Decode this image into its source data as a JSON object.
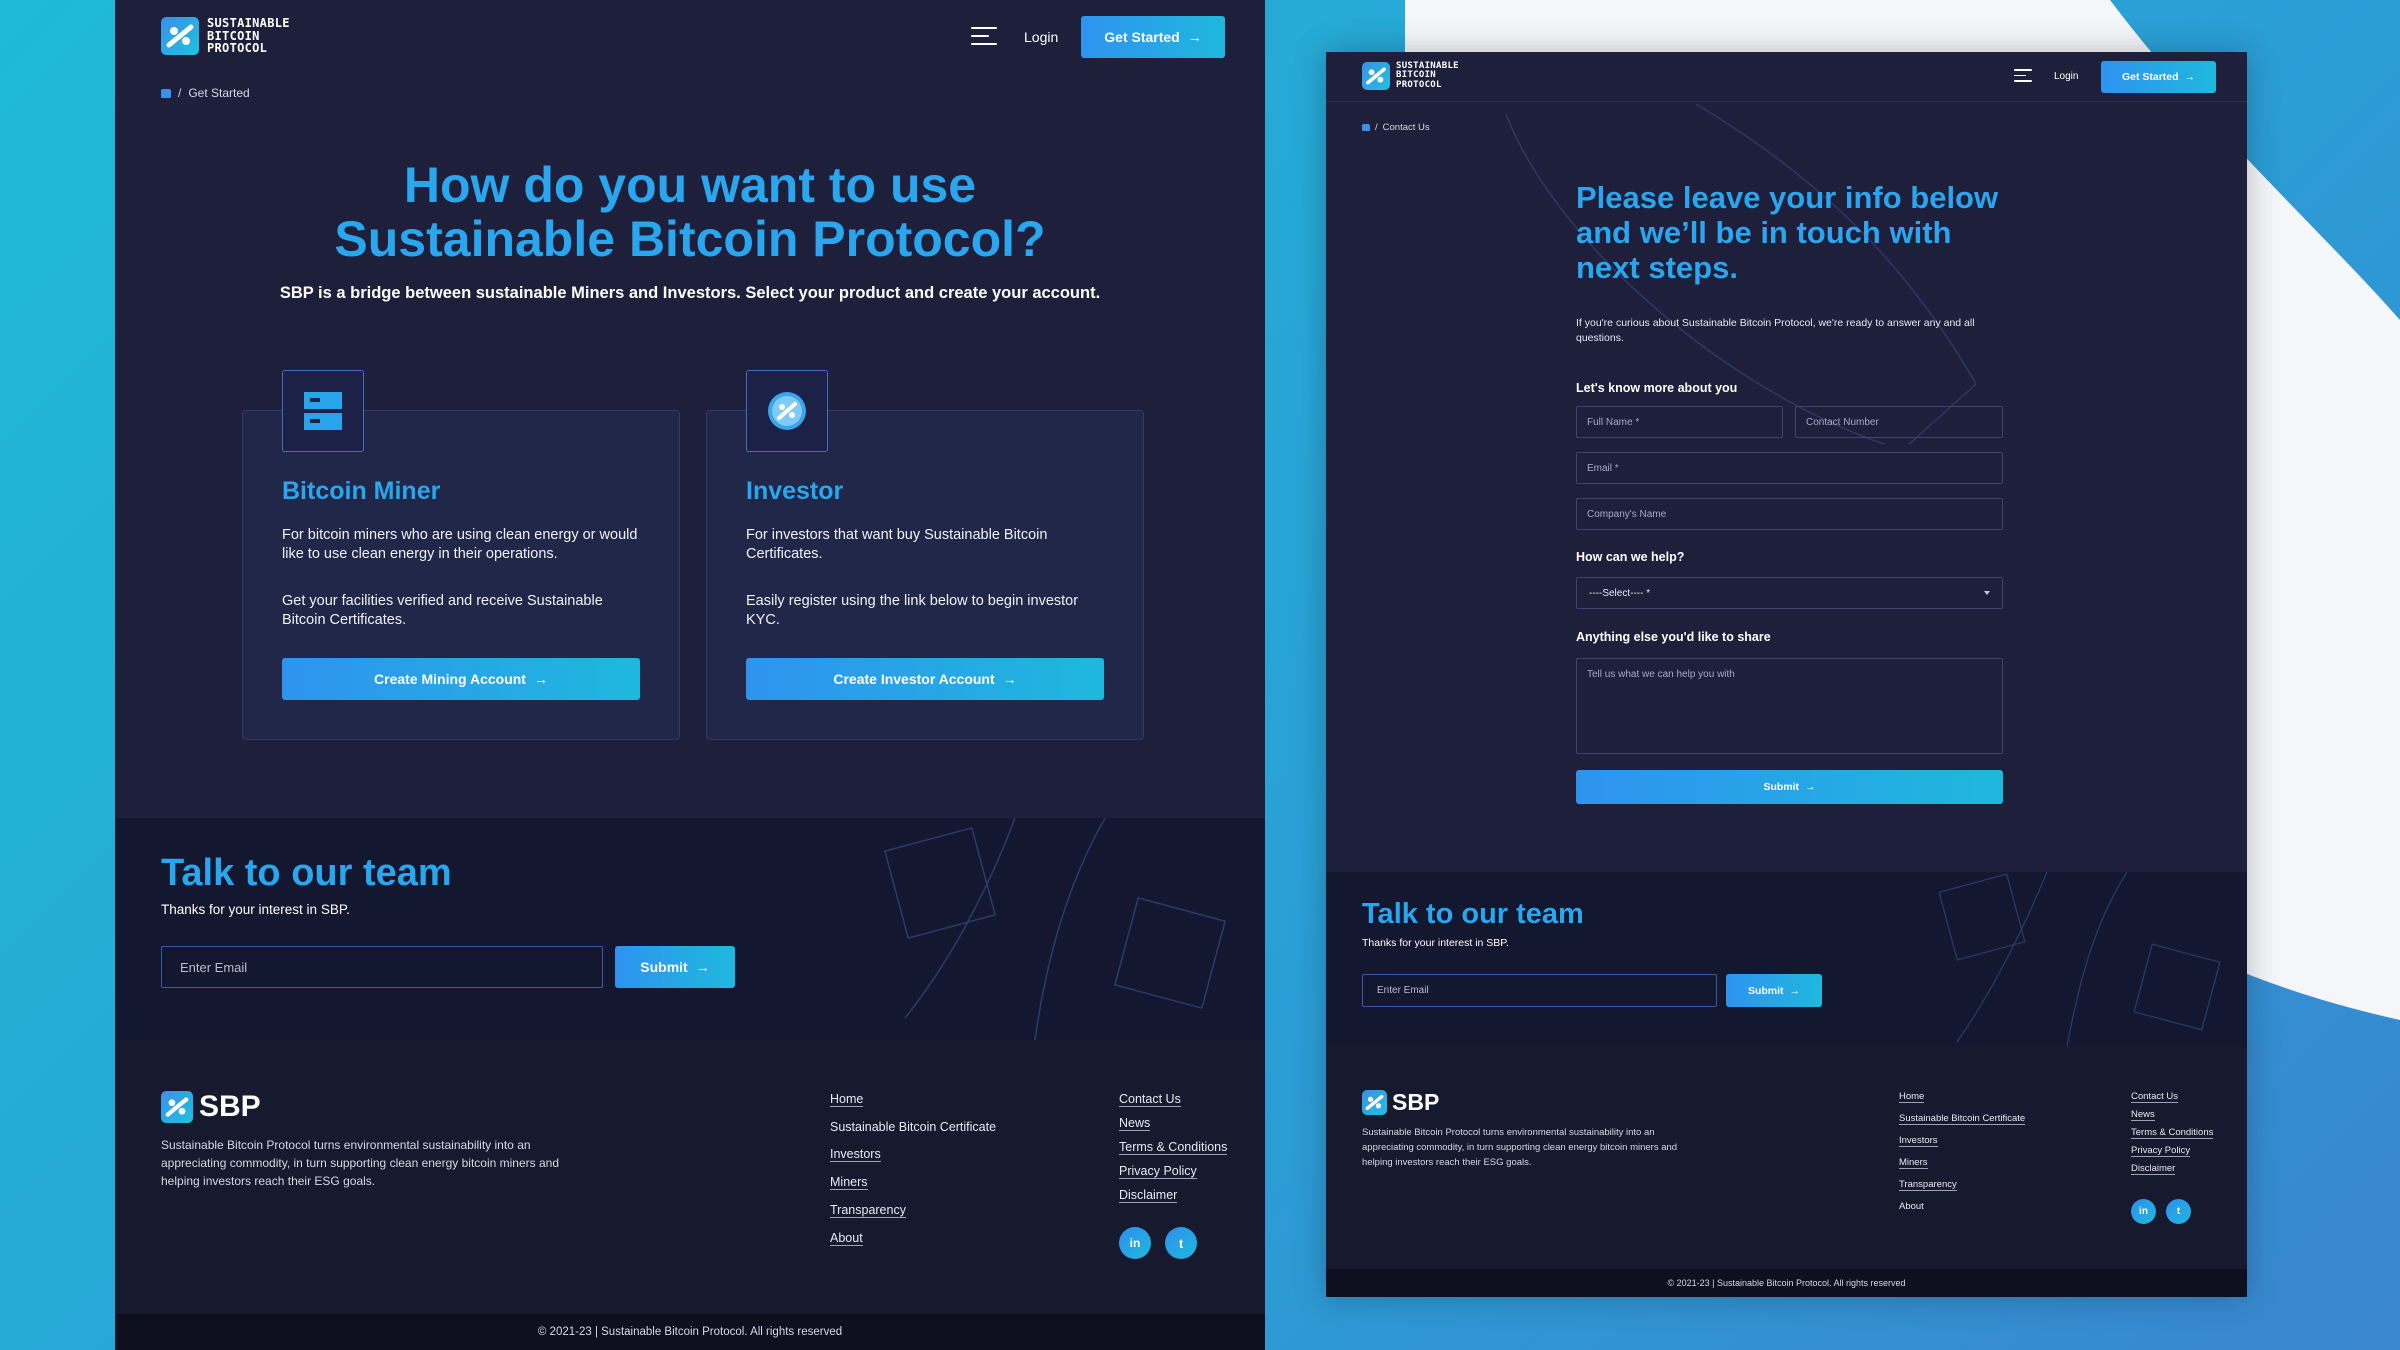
{
  "brand": {
    "logo_text_lines": [
      "SUSTAINABLE",
      "BITCOIN",
      "PROTOCOL"
    ],
    "short_name": "SBP",
    "accent_color": "#2aa6ee",
    "background_color": "#1d1f3b"
  },
  "left_page": {
    "nav": {
      "login_label": "Login",
      "cta_label": "Get Started",
      "cta_arrow": "→"
    },
    "breadcrumb": {
      "separator": "/",
      "current": "Get Started"
    },
    "hero": {
      "title_line1": "How do you want to use",
      "title_line2": "Sustainable Bitcoin Protocol?",
      "subtitle": "SBP is a bridge between sustainable Miners and Investors. Select your product and create your account."
    },
    "cards": [
      {
        "icon": "server-icon",
        "title": "Bitcoin Miner",
        "text1": "For bitcoin miners who are using clean energy or would like to use clean energy in their operations.",
        "text2": "Get your facilities verified and receive Sustainable Bitcoin Certificates.",
        "button_label": "Create Mining Account",
        "button_arrow": "→"
      },
      {
        "icon": "sbp-coin-icon",
        "title": "Investor",
        "text1": "For investors that want buy Sustainable Bitcoin Certificates.",
        "text2": "Easily register using the link below to begin investor KYC.",
        "button_label": "Create Investor Account",
        "button_arrow": "→"
      }
    ],
    "talk": {
      "title": "Talk to our team",
      "subtitle": "Thanks for your interest in SBP.",
      "email_placeholder": "Enter Email",
      "submit_label": "Submit",
      "submit_arrow": "→"
    },
    "footer": {
      "description": "Sustainable Bitcoin Protocol turns environmental sustainability into an appreciating commodity, in turn supporting clean energy bitcoin miners and helping investors reach their ESG goals.",
      "links_col1": [
        "Home",
        "Sustainable Bitcoin Certificate",
        "Investors",
        "Miners",
        "Transparency",
        "About"
      ],
      "links_col2": [
        "Contact Us",
        "News",
        "Terms & Conditions",
        "Privacy Policy",
        "Disclaimer"
      ],
      "social": [
        "linkedin-icon",
        "twitter-icon"
      ],
      "copyright": "© 2021-23 | Sustainable Bitcoin Protocol. All rights reserved"
    }
  },
  "right_page": {
    "nav": {
      "login_label": "Login",
      "cta_label": "Get Started",
      "cta_arrow": "→"
    },
    "breadcrumb": {
      "separator": "/",
      "current": "Contact Us"
    },
    "form": {
      "title_line1": "Please leave your info below",
      "title_line2": "and we’ll be in touch with",
      "title_line3": "next steps.",
      "intro": "If you're curious about Sustainable Bitcoin Protocol, we're ready to answer any and all questions.",
      "section1_label": "Let's know more about you",
      "full_name_placeholder": "Full Name *",
      "contact_number_placeholder": "Contact Number",
      "email_placeholder": "Email *",
      "company_placeholder": "Company's Name",
      "section2_label": "How can we help?",
      "select_value": "----Select---- *",
      "section3_label": "Anything else you'd like to share",
      "message_placeholder": "Tell us what we can help you with",
      "submit_label": "Submit",
      "submit_arrow": "→"
    },
    "talk": {
      "title": "Talk to our team",
      "subtitle": "Thanks for your interest in SBP.",
      "email_placeholder": "Enter Email",
      "submit_label": "Submit",
      "submit_arrow": "→"
    },
    "footer": {
      "description": "Sustainable Bitcoin Protocol turns environmental sustainability into an appreciating commodity, in turn supporting clean energy bitcoin miners and helping investors reach their ESG goals.",
      "links_col1": [
        "Home",
        "Sustainable Bitcoin Certificate",
        "Investors",
        "Miners",
        "Transparency",
        "About"
      ],
      "links_col2": [
        "Contact Us",
        "News",
        "Terms & Conditions",
        "Privacy Policy",
        "Disclaimer"
      ],
      "social": [
        "linkedin-icon",
        "twitter-icon"
      ],
      "copyright": "© 2021-23 | Sustainable Bitcoin Protocol. All rights reserved"
    }
  }
}
